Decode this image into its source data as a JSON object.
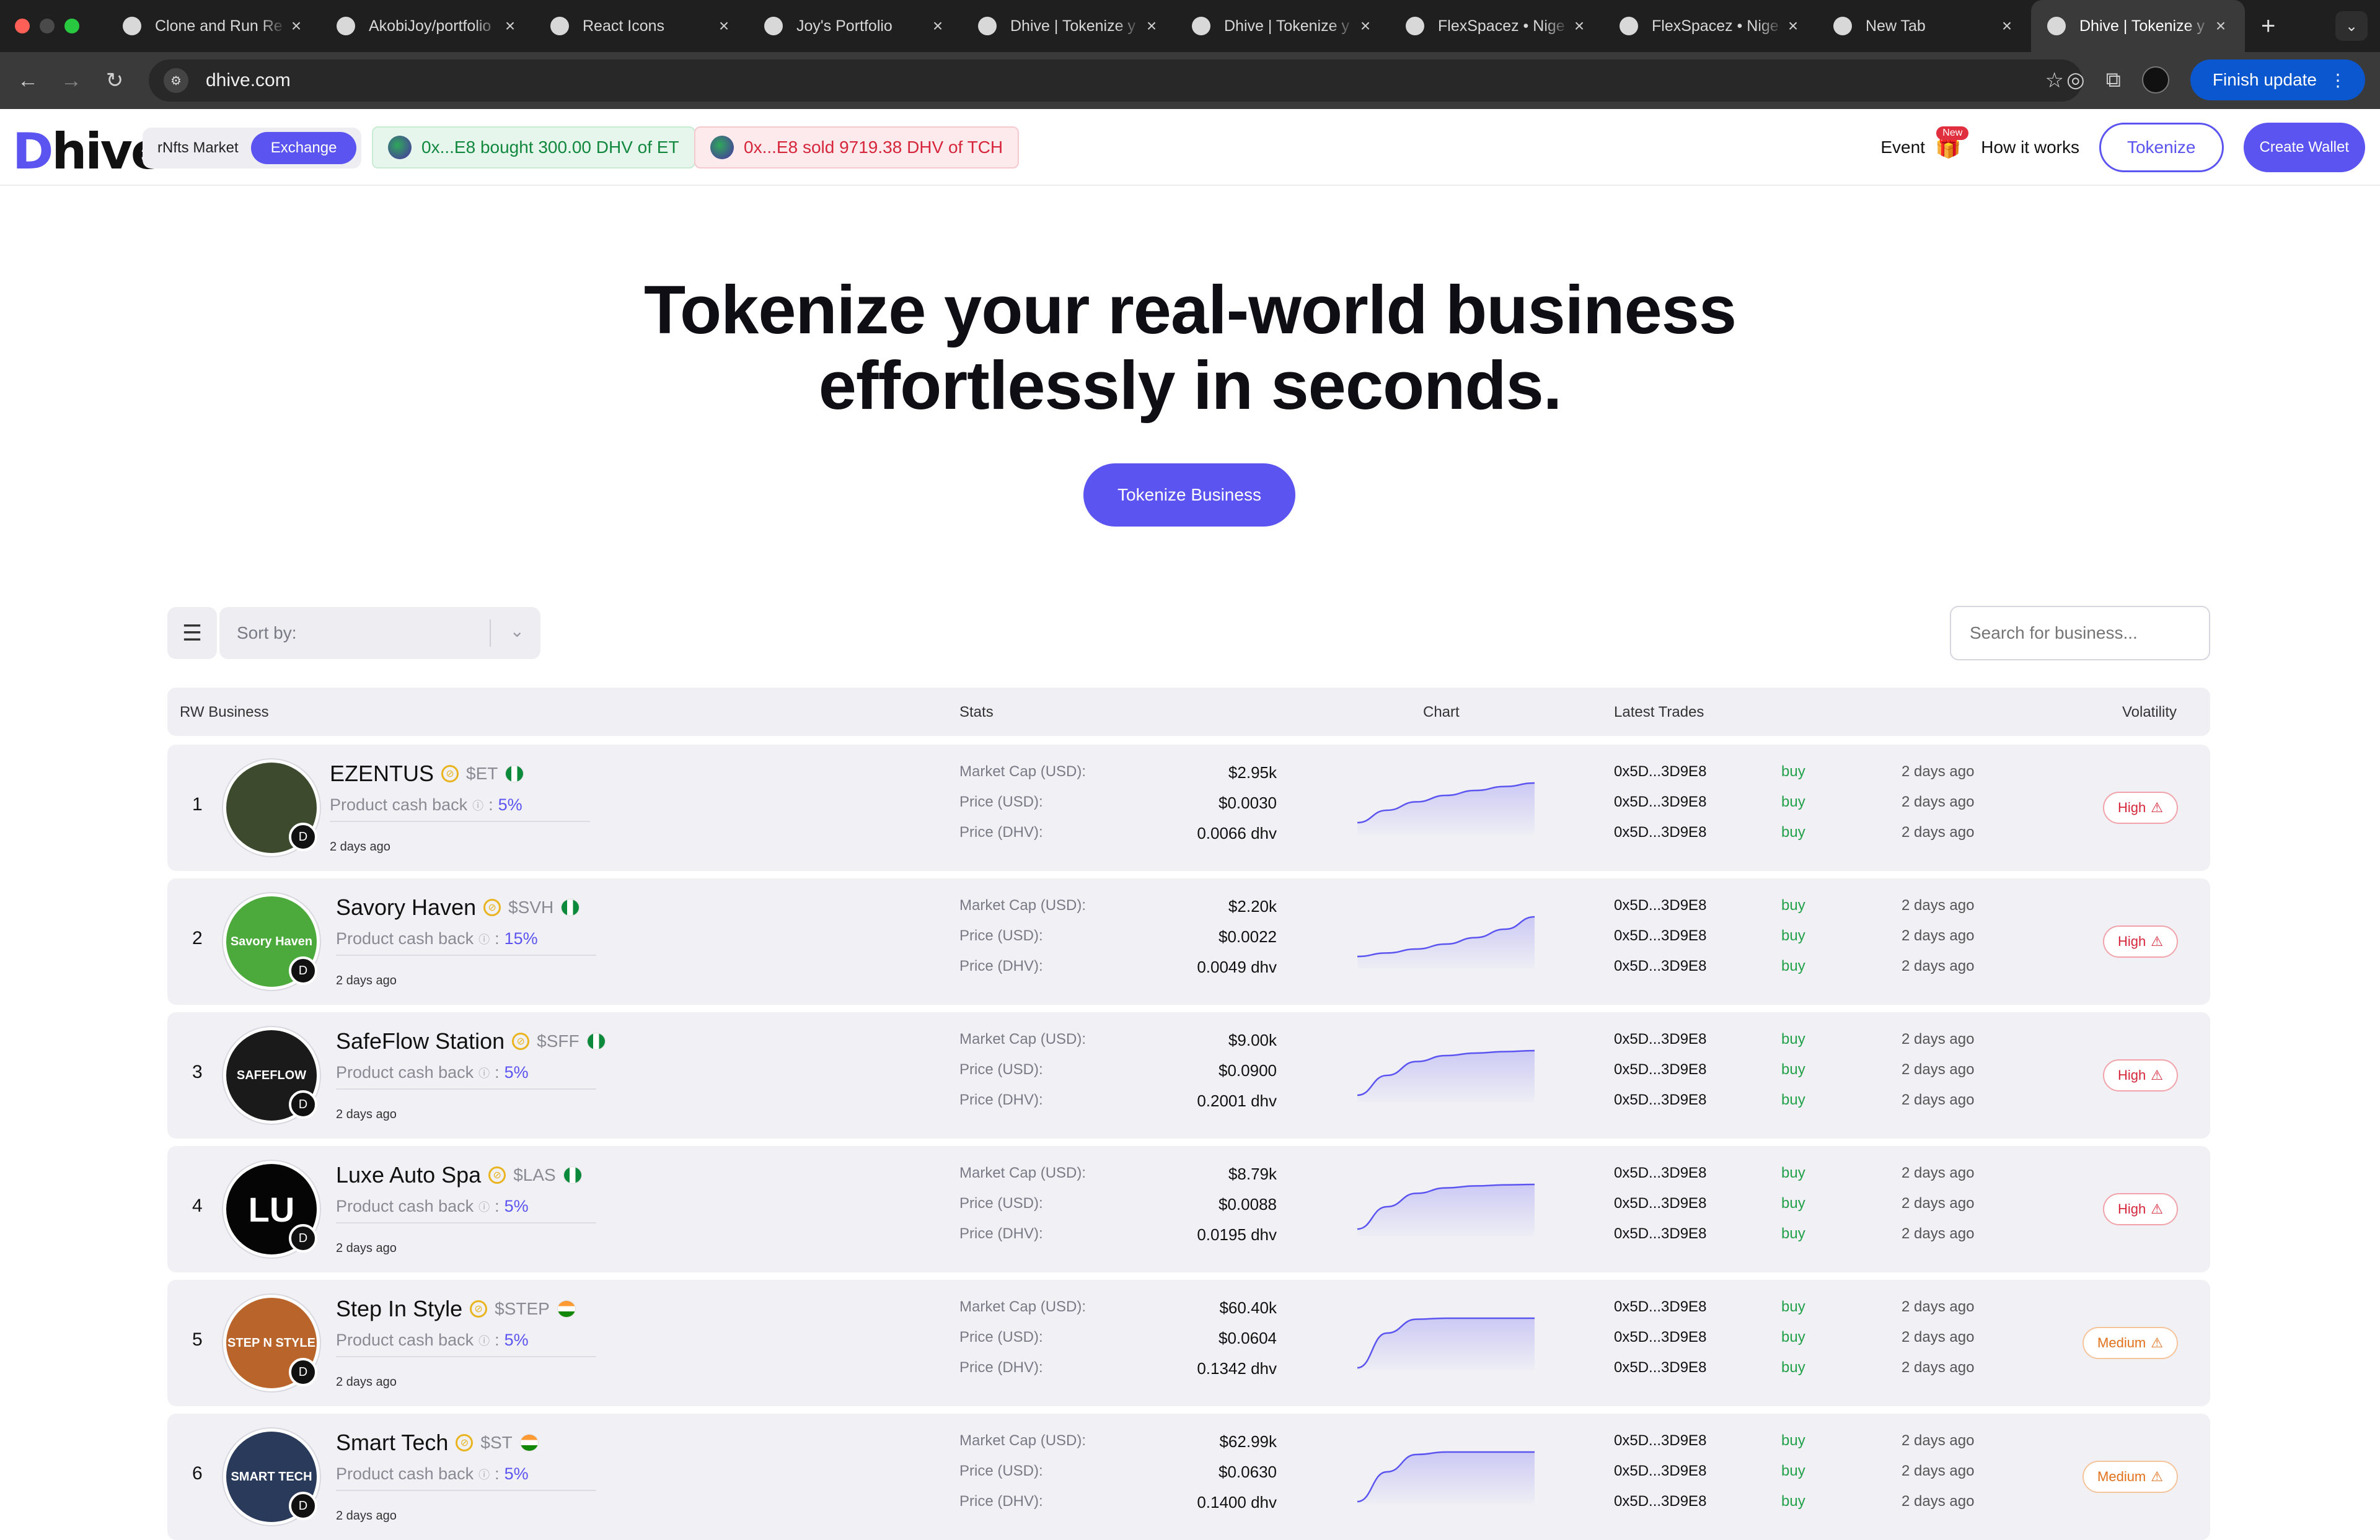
{
  "browser": {
    "tabs": [
      {
        "label": "Clone and Run Re",
        "icon": "openai-icon"
      },
      {
        "label": "AkobiJoy/portfolio",
        "icon": "github-icon"
      },
      {
        "label": "React Icons",
        "icon": "react-icon"
      },
      {
        "label": "Joy's Portfolio",
        "icon": "globe-icon"
      },
      {
        "label": "Dhive | Tokenize y",
        "icon": "dhive-icon"
      },
      {
        "label": "Dhive | Tokenize y",
        "icon": "dhive-icon"
      },
      {
        "label": "FlexSpacez • Nige",
        "icon": "flexspacez-icon"
      },
      {
        "label": "FlexSpacez • Nige",
        "icon": "flexspacez-icon"
      },
      {
        "label": "New Tab",
        "icon": "chrome-icon"
      },
      {
        "label": "Dhive | Tokenize y",
        "icon": "dhive-icon"
      }
    ],
    "url": "dhive.com",
    "finish_update": "Finish update"
  },
  "header": {
    "logo": "Dhive",
    "segment": {
      "option1": "rNfts Market",
      "option2": "Exchange"
    },
    "ticker_buy": "0x...E8 bought 300.00 DHV of ET",
    "ticker_sell": "0x...E8 sold 9719.38 DHV of TCH",
    "event": "Event",
    "event_badge": "New",
    "how_it_works": "How it works",
    "tokenize": "Tokenize",
    "create_wallet": "Create Wallet"
  },
  "hero": {
    "line1": "Tokenize your real-world business",
    "line2": "effortlessly in seconds.",
    "cta": "Tokenize Business"
  },
  "controls": {
    "sort_placeholder": "Sort by:",
    "search_placeholder": "Search for business..."
  },
  "table": {
    "columns": {
      "business": "RW Business",
      "stats": "Stats",
      "chart": "Chart",
      "trades": "Latest Trades",
      "volatility": "Volatility"
    },
    "labels": {
      "market_cap": "Market Cap (USD):",
      "price_usd": "Price (USD):",
      "price_dhv": "Price (DHV):",
      "cashback": "Product cash back"
    },
    "rows": [
      {
        "rank": "1",
        "name": "EZENTUS",
        "ticker": "$ET",
        "flag": "ng",
        "cashback": "5%",
        "ago": "2 days ago",
        "market_cap": "$2.95k",
        "price_usd": "$0.0030",
        "price_dhv": "0.0066 dhv",
        "volatility": "High",
        "chart": [
          0.2,
          0.45,
          0.62,
          0.75,
          0.85,
          0.93,
          1.0
        ],
        "logo_color": "#3d4a2e",
        "logo_text": ""
      },
      {
        "rank": "2",
        "name": "Savory Haven",
        "ticker": "$SVH",
        "flag": "ng",
        "cashback": "15%",
        "ago": "2 days ago",
        "market_cap": "$2.20k",
        "price_usd": "$0.0022",
        "price_dhv": "0.0049 dhv",
        "volatility": "High",
        "chart": [
          0.2,
          0.27,
          0.35,
          0.45,
          0.58,
          0.75,
          1.0
        ],
        "logo_color": "#4caa3c",
        "logo_text": "Savory Haven"
      },
      {
        "rank": "3",
        "name": "SafeFlow Station",
        "ticker": "$SFF",
        "flag": "ng",
        "cashback": "5%",
        "ago": "2 days ago",
        "market_cap": "$9.00k",
        "price_usd": "$0.0900",
        "price_dhv": "0.2001 dhv",
        "volatility": "High",
        "chart": [
          0.1,
          0.5,
          0.78,
          0.9,
          0.95,
          0.98,
          1.0
        ],
        "logo_color": "#1a1a1a",
        "logo_text": "SAFEFLOW"
      },
      {
        "rank": "4",
        "name": "Luxe Auto Spa",
        "ticker": "$LAS",
        "flag": "ng",
        "cashback": "5%",
        "ago": "2 days ago",
        "market_cap": "$8.79k",
        "price_usd": "$0.0088",
        "price_dhv": "0.0195 dhv",
        "volatility": "High",
        "chart": [
          0.1,
          0.55,
          0.82,
          0.93,
          0.97,
          0.99,
          1.0
        ],
        "logo_color": "#050505",
        "logo_text": "LU"
      },
      {
        "rank": "5",
        "name": "Step In Style",
        "ticker": "$STEP",
        "flag": "in",
        "cashback": "5%",
        "ago": "2 days ago",
        "market_cap": "$60.40k",
        "price_usd": "$0.0604",
        "price_dhv": "0.1342 dhv",
        "volatility": "Medium",
        "chart": [
          0.0,
          0.7,
          0.98,
          1.0,
          1.0,
          1.0,
          1.0
        ],
        "logo_color": "#b8642a",
        "logo_text": "STEP N STYLE"
      },
      {
        "rank": "6",
        "name": "Smart Tech",
        "ticker": "$ST",
        "flag": "in",
        "cashback": "5%",
        "ago": "2 days ago",
        "market_cap": "$62.99k",
        "price_usd": "$0.0630",
        "price_dhv": "0.1400 dhv",
        "volatility": "Medium",
        "chart": [
          0.0,
          0.6,
          0.95,
          1.0,
          1.0,
          1.0,
          1.0
        ],
        "logo_color": "#2a3a5a",
        "logo_text": "SMART TECH"
      }
    ],
    "trade": {
      "addr": "0x5D...3D9E8",
      "type": "buy",
      "ago": "2 days ago"
    }
  },
  "colors": {
    "accent": "#5b54f0",
    "buy": "#22a04a",
    "high": "#d6263b",
    "medium": "#e2701b"
  }
}
